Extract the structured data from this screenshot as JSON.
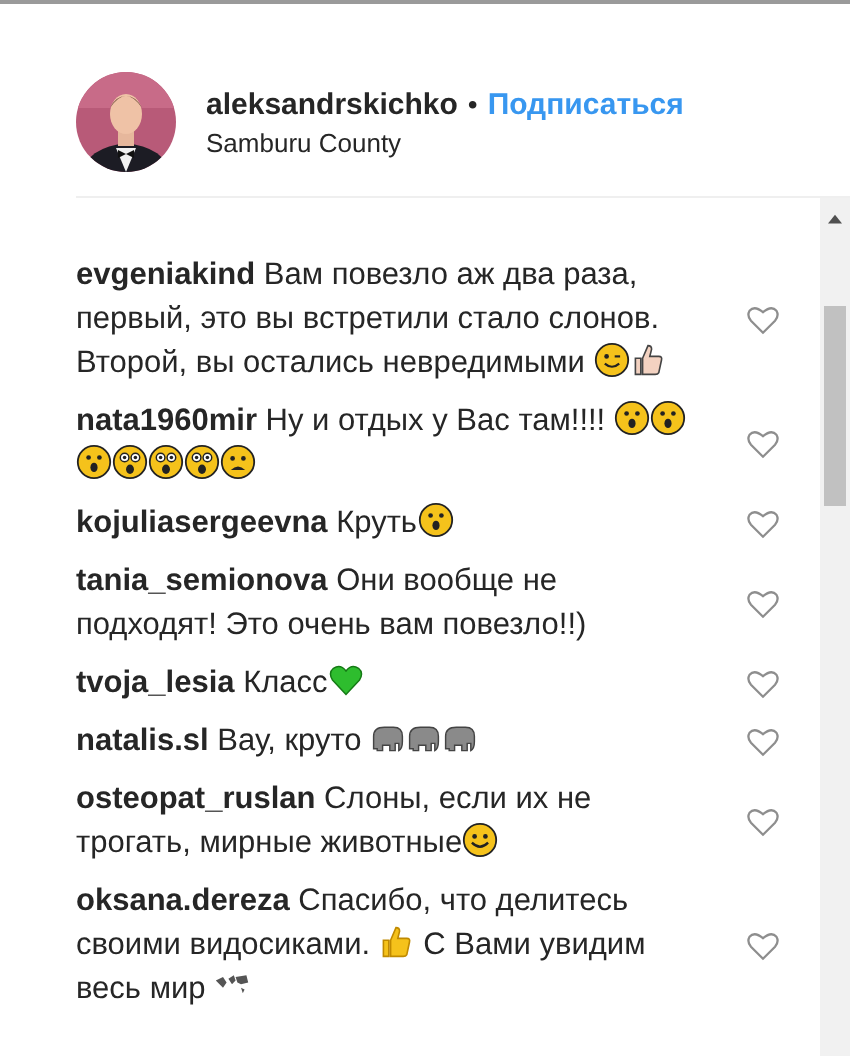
{
  "post_header": {
    "username": "aleksandrskichko",
    "separator": "•",
    "follow_link": "Подписаться",
    "location": "Samburu County"
  },
  "comments": [
    {
      "username": "evgeniakind",
      "liked": false,
      "parts": [
        {
          "kind": "text",
          "text": "Вам повезло аж два раза, первый, это вы встретили стало слонов. Второй, вы остались невредимыми "
        },
        {
          "kind": "wink"
        },
        {
          "kind": "thumbs-up-pale"
        }
      ]
    },
    {
      "username": "nata1960mir",
      "liked": false,
      "parts": [
        {
          "kind": "text",
          "text": "Ну и отдых у Вас там!!!! "
        },
        {
          "kind": "surprised"
        },
        {
          "kind": "surprised"
        },
        {
          "kind": "surprised"
        },
        {
          "kind": "astonished"
        },
        {
          "kind": "astonished"
        },
        {
          "kind": "astonished"
        },
        {
          "kind": "frown"
        }
      ]
    },
    {
      "username": "kojuliasergeevna",
      "liked": false,
      "parts": [
        {
          "kind": "text",
          "text": "Круть"
        },
        {
          "kind": "surprised"
        }
      ]
    },
    {
      "username": "tania_semionova",
      "liked": false,
      "parts": [
        {
          "kind": "text",
          "text": "Они вообще не подходят! Это очень вам повезло!!)"
        }
      ]
    },
    {
      "username": "tvoja_lesia",
      "liked": false,
      "parts": [
        {
          "kind": "text",
          "text": "Класс"
        },
        {
          "kind": "green-heart"
        }
      ]
    },
    {
      "username": "natalis.sl",
      "liked": false,
      "parts": [
        {
          "kind": "text",
          "text": "Вау, круто "
        },
        {
          "kind": "elephant"
        },
        {
          "kind": "elephant"
        },
        {
          "kind": "elephant"
        }
      ]
    },
    {
      "username": "osteopat_ruslan",
      "liked": false,
      "parts": [
        {
          "kind": "text",
          "text": "Слоны, если их не трогать, мирные животные"
        },
        {
          "kind": "smile"
        }
      ]
    },
    {
      "username": "oksana.dereza",
      "liked": false,
      "parts": [
        {
          "kind": "text",
          "text": "Спасибо, что делитесь своими видосиками. "
        },
        {
          "kind": "thumbs-up"
        },
        {
          "kind": "text",
          "text": " С Вами увидим весь мир "
        },
        {
          "kind": "world-map"
        }
      ]
    }
  ]
}
